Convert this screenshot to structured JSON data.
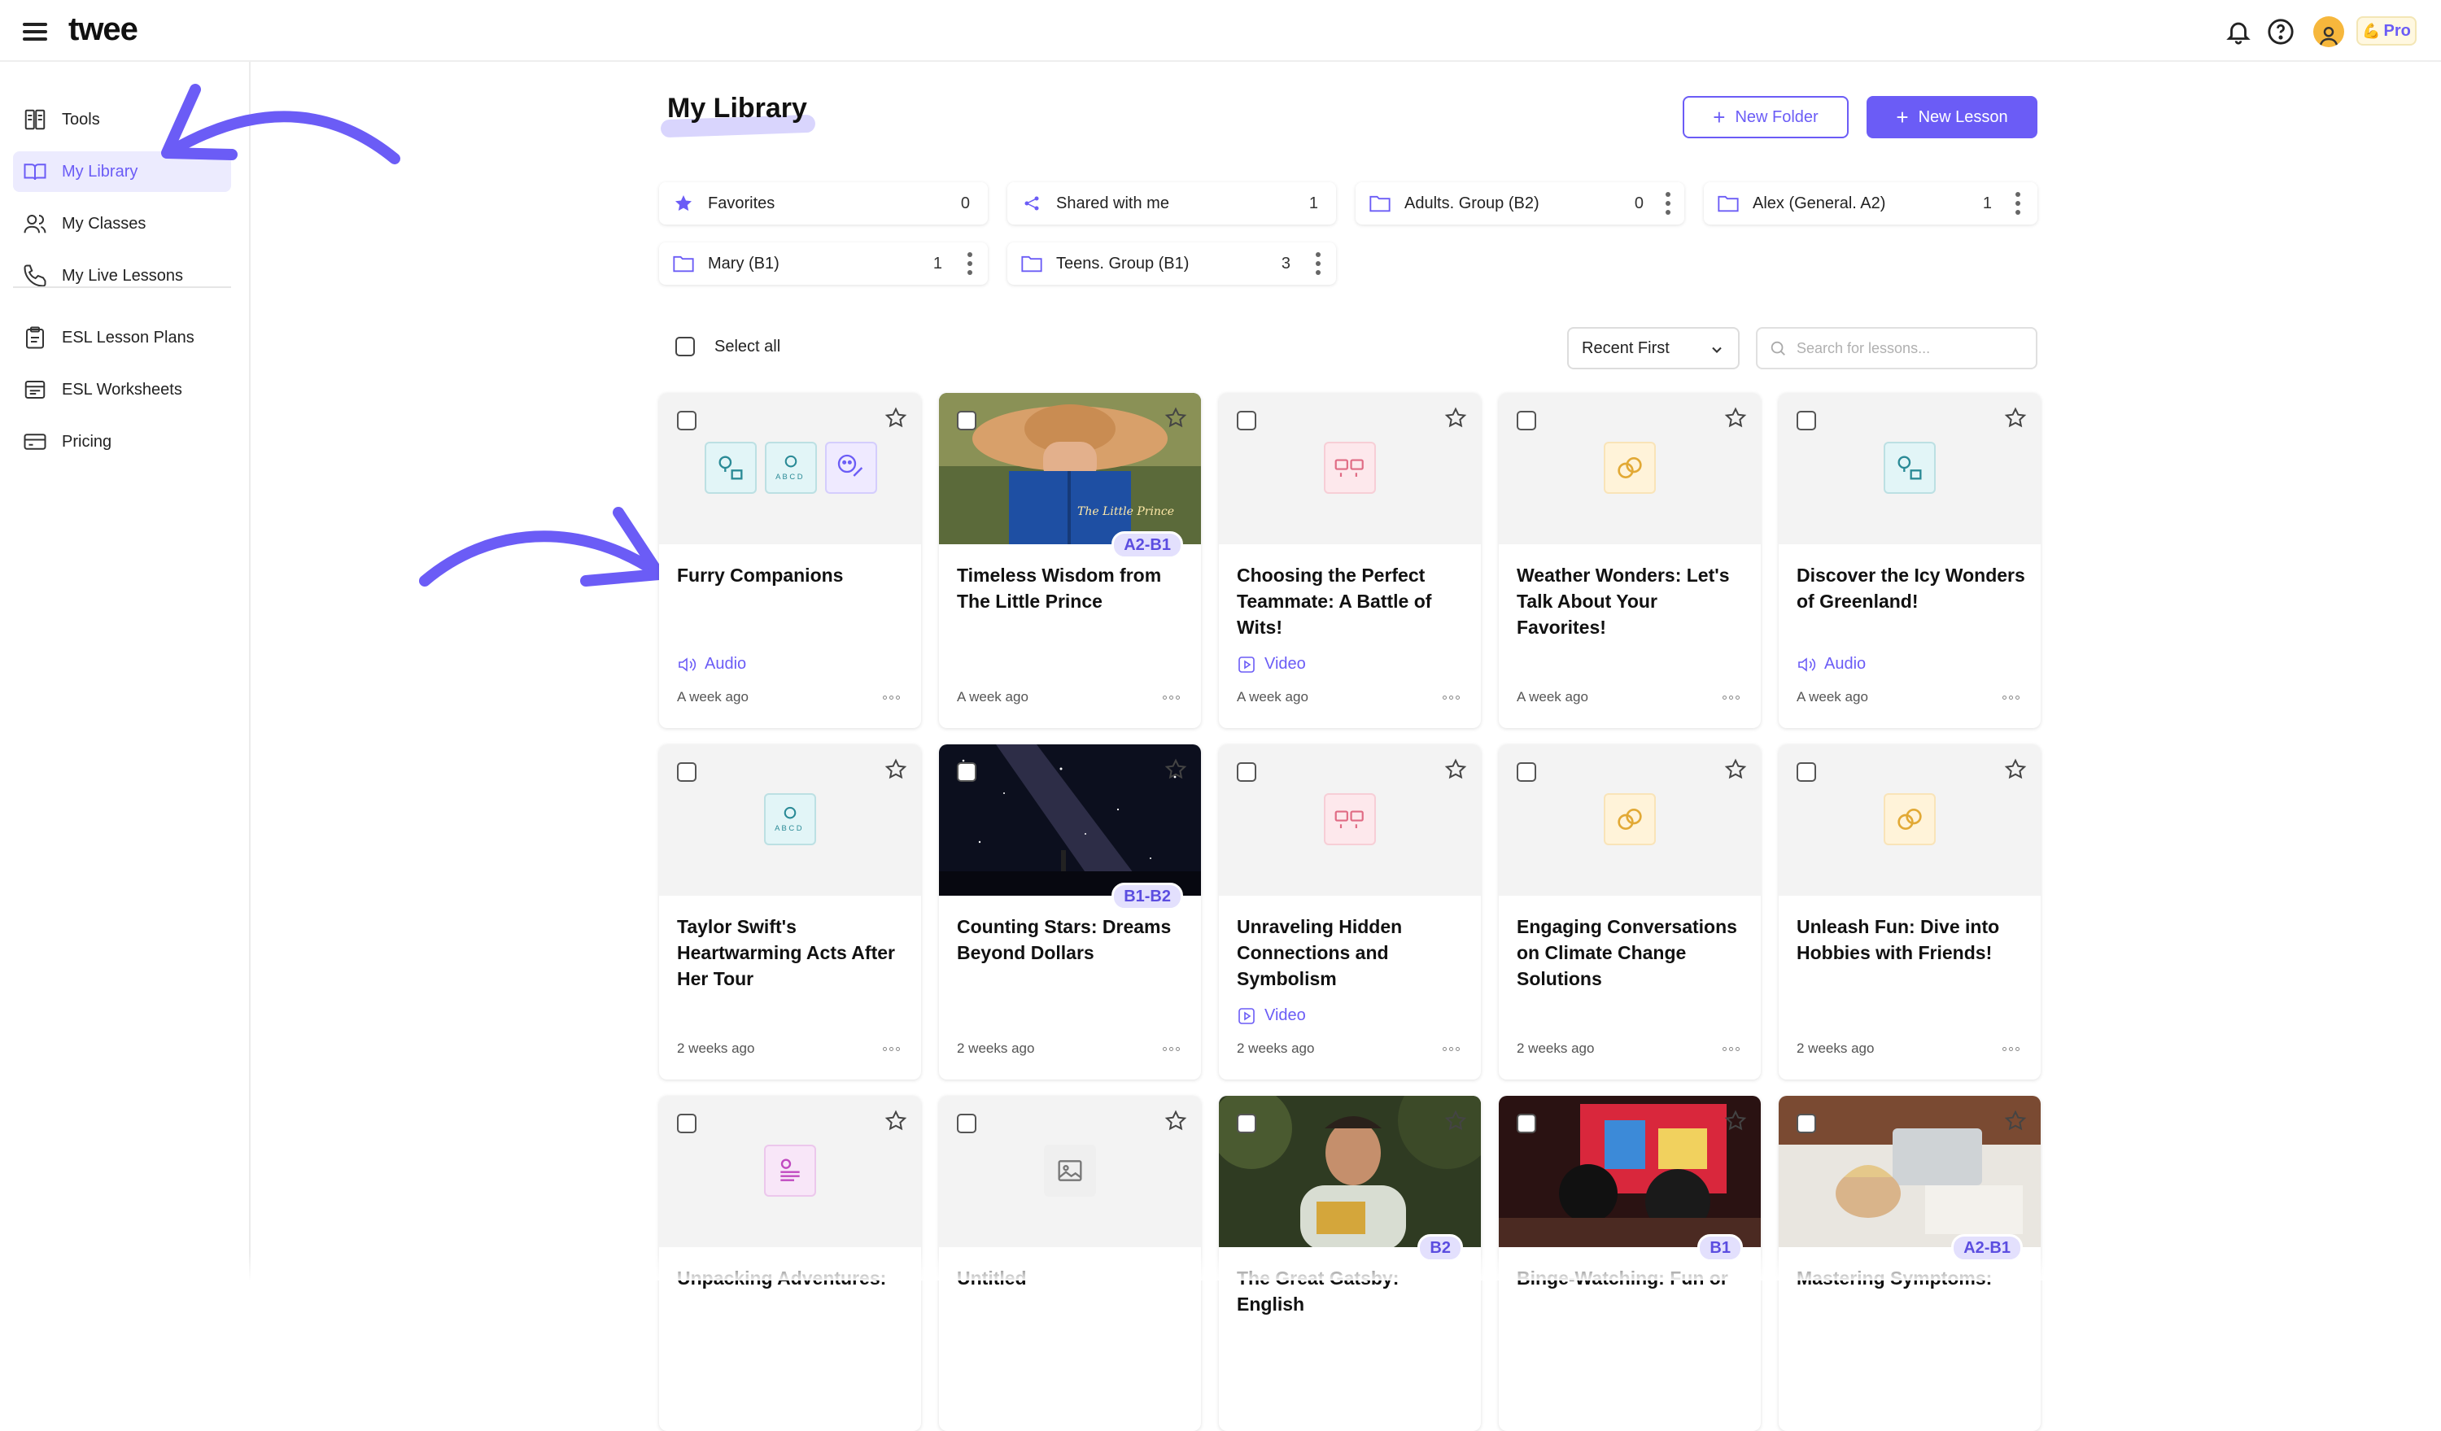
{
  "app": {
    "logo": "twee",
    "pro_label": "Pro"
  },
  "sidebar": {
    "items": [
      {
        "label": "Tools",
        "icon": "tools-icon"
      },
      {
        "label": "My Library",
        "icon": "book-icon",
        "active": true
      },
      {
        "label": "My Classes",
        "icon": "users-icon"
      },
      {
        "label": "My Live Lessons",
        "icon": "phone-icon"
      },
      {
        "label": "ESL Lesson Plans",
        "icon": "clipboard-icon"
      },
      {
        "label": "ESL Worksheets",
        "icon": "worksheet-icon"
      },
      {
        "label": "Pricing",
        "icon": "card-icon"
      }
    ]
  },
  "main": {
    "title": "My Library",
    "new_folder_label": "New Folder",
    "new_lesson_label": "New Lesson",
    "select_all_label": "Select all",
    "sort_value": "Recent First",
    "search_placeholder": "Search for lessons..."
  },
  "folders": [
    {
      "name": "Favorites",
      "count": "0",
      "icon": "star-icon"
    },
    {
      "name": "Shared with me",
      "count": "1",
      "icon": "share-icon"
    },
    {
      "name": "Adults. Group (B2)",
      "count": "0",
      "icon": "folder-icon"
    },
    {
      "name": "Alex (General. A2)",
      "count": "1",
      "icon": "folder-icon"
    },
    {
      "name": "Mary (B1)",
      "count": "1",
      "icon": "folder-icon"
    },
    {
      "name": "Teens. Group (B1)",
      "count": "3",
      "icon": "folder-icon"
    }
  ],
  "lessons": [
    {
      "title": "Furry Companions",
      "type": "Audio",
      "date": "A week ago"
    },
    {
      "title": "Timeless Wisdom from The Little Prince",
      "type": "",
      "date": "A week ago",
      "level": "A2-B1"
    },
    {
      "title": "Choosing the Perfect Teammate: A Battle of Wits!",
      "type": "Video",
      "date": "A week ago"
    },
    {
      "title": "Weather Wonders: Let's Talk About Your Favorites!",
      "type": "",
      "date": "A week ago"
    },
    {
      "title": "Discover the Icy Wonders of Greenland!",
      "type": "Audio",
      "date": "A week ago"
    },
    {
      "title": "Taylor Swift's Heartwarming Acts After Her Tour",
      "type": "",
      "date": "2 weeks ago"
    },
    {
      "title": "Counting Stars: Dreams Beyond Dollars",
      "type": "",
      "date": "2 weeks ago",
      "level": "B1-B2"
    },
    {
      "title": "Unraveling Hidden Connections and Symbolism",
      "type": "Video",
      "date": "2 weeks ago"
    },
    {
      "title": "Engaging Conversations on Climate Change Solutions",
      "type": "",
      "date": "2 weeks ago"
    },
    {
      "title": "Unleash Fun: Dive into Hobbies with Friends!",
      "type": "",
      "date": "2 weeks ago"
    },
    {
      "title": "Unpacking Adventures:",
      "type": "",
      "date": ""
    },
    {
      "title": "Untitled",
      "type": "",
      "date": ""
    },
    {
      "title": "The Great Gatsby: English",
      "type": "",
      "date": "",
      "level": "B2"
    },
    {
      "title": "Binge-Watching: Fun or",
      "type": "",
      "date": "",
      "level": "B1"
    },
    {
      "title": "Mastering Symptoms:",
      "type": "",
      "date": "",
      "level": "A2-B1"
    }
  ],
  "colors": {
    "accent": "#6b5cf6",
    "accent_light": "#ecebfe",
    "badge_bg": "#e3e0fd"
  }
}
